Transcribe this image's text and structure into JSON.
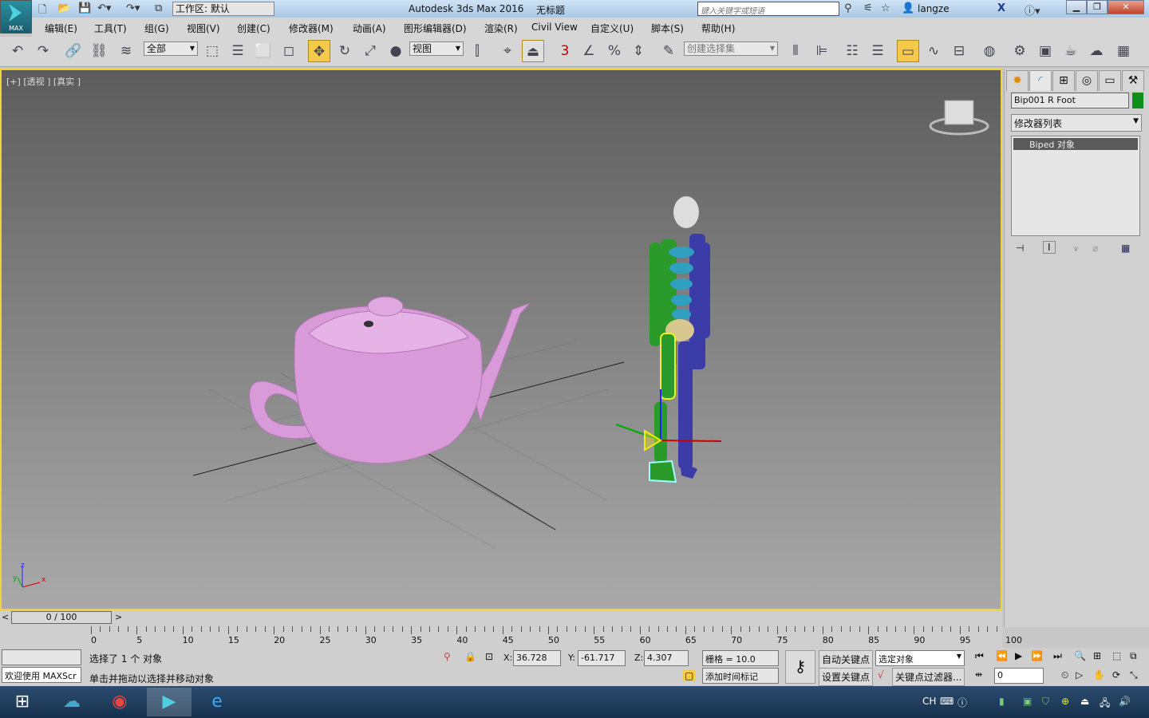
{
  "title_bar": {
    "app_title": "Autodesk 3ds Max 2016",
    "document_title": "无标题",
    "workspace": "工作区: 默认",
    "search_placeholder": "键入关键字或短语",
    "user": "langze",
    "app_button_label": "MAX"
  },
  "menu": [
    "编辑(E)",
    "工具(T)",
    "组(G)",
    "视图(V)",
    "创建(C)",
    "修改器(M)",
    "动画(A)",
    "图形编辑器(D)",
    "渲染(R)",
    "Civil View",
    "自定义(U)",
    "脚本(S)",
    "帮助(H)"
  ],
  "toolbar": {
    "selection_filter": "全部",
    "reference_coord": "视图",
    "named_selection_placeholder": "创建选择集",
    "snap_label": "3"
  },
  "viewport": {
    "label_plus": "[+]",
    "label_view": "[透视 ]",
    "label_shading": "[真实 ]",
    "axis_x": "x",
    "axis_y": "y",
    "axis_z": "z",
    "teapot_color": "#d89ad8",
    "border_color": "#f0d23a"
  },
  "command_panel": {
    "object_name": "Bip001 R Foot",
    "object_color": "#0f8f1a",
    "modifier_list": "修改器列表",
    "stack_item": "Biped 对象"
  },
  "timeline": {
    "frame_display": "0 / 100",
    "prev": "<",
    "next": ">",
    "ticks": [
      "0",
      "5",
      "10",
      "15",
      "20",
      "25",
      "30",
      "35",
      "40",
      "45",
      "50",
      "55",
      "60",
      "65",
      "70",
      "75",
      "80",
      "85",
      "90",
      "95",
      "100"
    ]
  },
  "status": {
    "maxscript": "欢迎使用 MAXScr",
    "selection_msg": "选择了 1 个 对象",
    "prompt": "单击并拖动以选择并移动对象",
    "x_label": "X:",
    "x": "36.728",
    "y_label": "Y:",
    "y": "-61.717",
    "z_label": "Z:",
    "z": "4.307",
    "grid": "栅格 = 10.0",
    "add_time_tag": "添加时间标记",
    "auto_key": "自动关键点",
    "set_key": "设置关键点",
    "key_mode": "选定对象",
    "key_filters": "关键点过滤器...",
    "current_frame": "0"
  },
  "taskbar": {
    "lang": "CH"
  }
}
